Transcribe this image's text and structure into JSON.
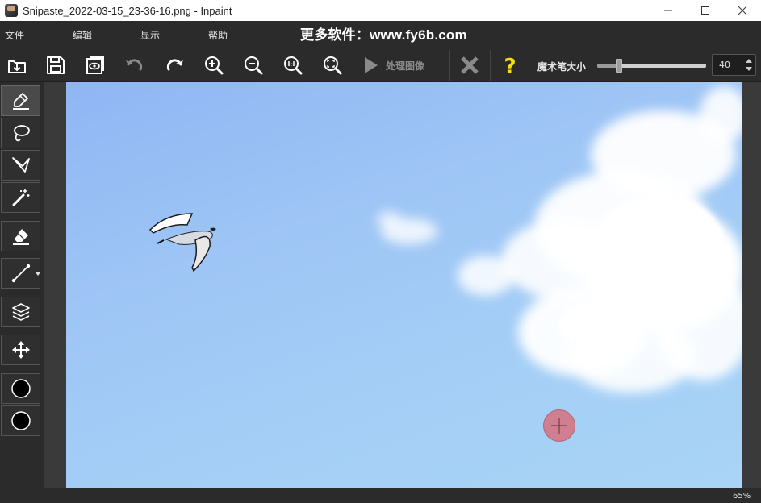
{
  "window": {
    "title": "Snipaste_2022-03-15_23-36-16.png - Inpaint",
    "controls": [
      "minimize",
      "maximize",
      "close"
    ]
  },
  "menu": {
    "items": [
      "文件",
      "编辑",
      "显示",
      "帮助"
    ],
    "banner": "更多软件：www.fy6b.com"
  },
  "toolbar": {
    "process_label": "处理图像",
    "brush_size_label": "魔术笔大小",
    "brush_size_value": "40",
    "brush_size_max": 200
  },
  "left_tools": [
    {
      "name": "marker-tool",
      "icon": "marker-icon",
      "active": true
    },
    {
      "name": "lasso-tool",
      "icon": "lasso-icon",
      "active": false
    },
    {
      "name": "polygon-lasso-tool",
      "icon": "polygon-lasso-icon",
      "active": false
    },
    {
      "name": "magic-wand-tool",
      "icon": "magic-wand-icon",
      "active": false
    },
    {
      "name": "eraser-tool",
      "icon": "eraser-icon",
      "active": false
    },
    {
      "name": "line-tool",
      "icon": "line-icon",
      "active": false
    },
    {
      "name": "layers-tool",
      "icon": "layers-icon",
      "active": false
    },
    {
      "name": "move-tool",
      "icon": "move-icon",
      "active": false
    },
    {
      "name": "foreground-color",
      "icon": "color-swatch-icon",
      "active": false
    },
    {
      "name": "background-color",
      "icon": "color-swatch-icon",
      "active": false
    }
  ],
  "status": {
    "zoom": "65%"
  },
  "colors": {
    "sky_top": "#8fb6f4",
    "sky_bottom": "#a8d4f6",
    "brush_cursor": "#cf7f90",
    "help_icon": "#f5e200"
  }
}
